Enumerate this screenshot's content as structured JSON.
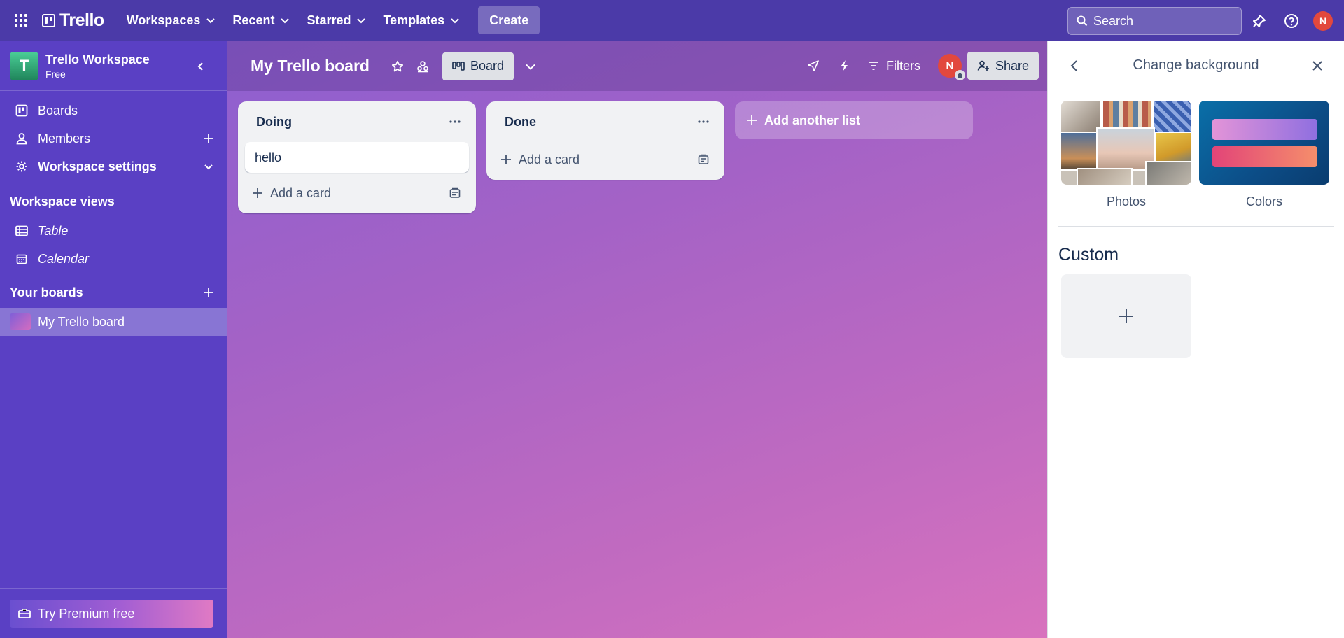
{
  "topbar": {
    "logo": "Trello",
    "nav": [
      {
        "label": "Workspaces"
      },
      {
        "label": "Recent"
      },
      {
        "label": "Starred"
      },
      {
        "label": "Templates"
      }
    ],
    "create_label": "Create",
    "search_placeholder": "Search",
    "avatar_initial": "N"
  },
  "sidebar": {
    "workspace_initial": "T",
    "workspace_name": "Trello Workspace",
    "workspace_plan": "Free",
    "items": [
      {
        "label": "Boards"
      },
      {
        "label": "Members"
      },
      {
        "label": "Workspace settings"
      }
    ],
    "views_heading": "Workspace views",
    "views": [
      {
        "label": "Table"
      },
      {
        "label": "Calendar"
      }
    ],
    "boards_heading": "Your boards",
    "boards": [
      {
        "label": "My Trello board"
      }
    ],
    "premium_label": "Try Premium free"
  },
  "board": {
    "title": "My Trello board",
    "view_label": "Board",
    "filters_label": "Filters",
    "member_initial": "N",
    "share_label": "Share",
    "lists": [
      {
        "title": "Doing",
        "cards": [
          "hello"
        ],
        "add_card_label": "Add a card"
      },
      {
        "title": "Done",
        "cards": [],
        "add_card_label": "Add a card"
      }
    ],
    "add_list_label": "Add another list"
  },
  "panel": {
    "title": "Change background",
    "options": [
      {
        "label": "Photos"
      },
      {
        "label": "Colors"
      }
    ],
    "custom_heading": "Custom"
  },
  "colors": {
    "topbar": "#4b3aa8",
    "sidebar": "#5a40c4",
    "avatar": "#e2483d",
    "workspace_logo": "#1f845a"
  }
}
